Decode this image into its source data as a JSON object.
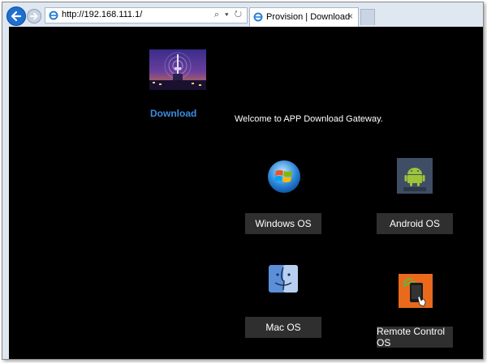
{
  "browser": {
    "url": "http://192.168.111.1/",
    "address_tools": "⌕ ▾ ↻",
    "tab_title": "Provision | Download",
    "tab_close": "×"
  },
  "page": {
    "nav_link": "Download",
    "welcome": "Welcome to APP Download Gateway.",
    "buttons": {
      "windows": "Windows OS",
      "android": "Android OS",
      "mac": "Mac OS",
      "remote": "Remote Control OS"
    }
  },
  "colors": {
    "page_background": "#000000",
    "link": "#3a8be0",
    "button_background": "#2f2f2f",
    "button_text": "#ffffff",
    "browser_chrome": "#dfe7f1"
  },
  "icons": [
    "back-arrow-icon",
    "forward-arrow-icon",
    "ie-icon",
    "windows-logo-icon",
    "android-logo-icon",
    "mac-finder-icon",
    "remote-control-icon"
  ]
}
